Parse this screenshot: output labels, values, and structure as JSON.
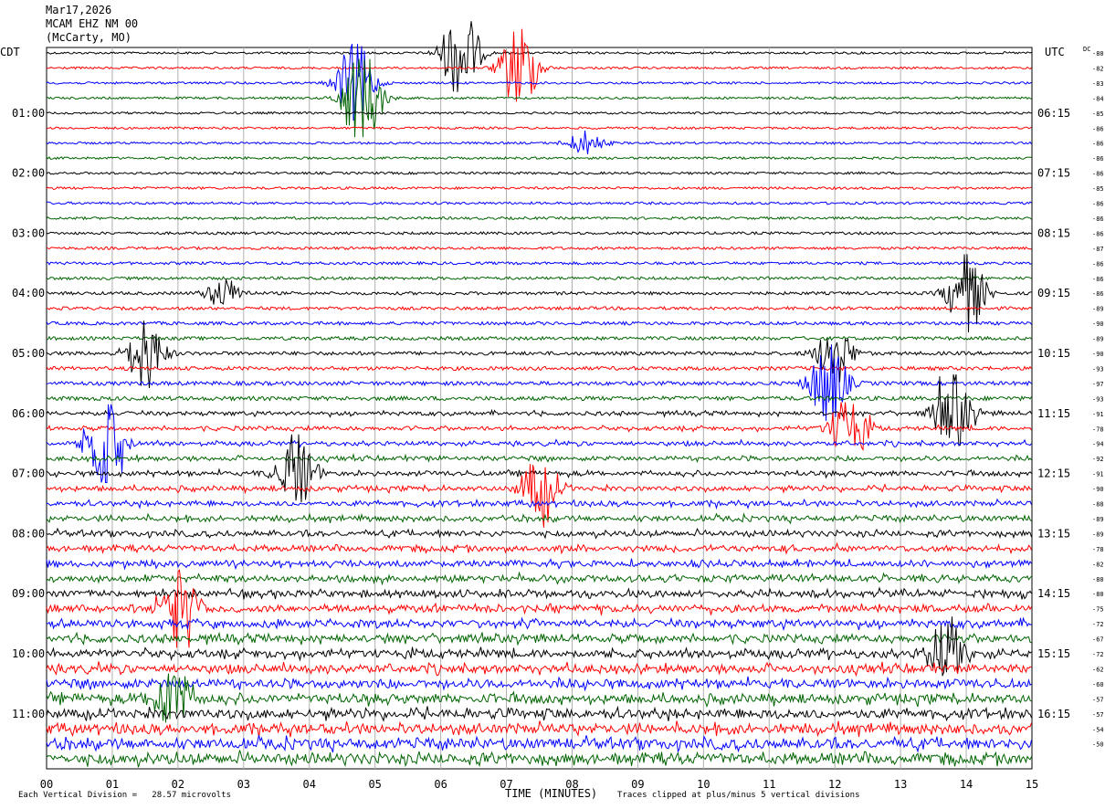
{
  "header": {
    "date": "Mar17,2026",
    "station": "MCAM EHZ NM 00",
    "location": "(McCarty, MO)"
  },
  "left_tz": "CDT",
  "right_tz": "UTC",
  "dc_label": "DC",
  "footer": {
    "scale_note": "Each Vertical Division =   28.57 microvolts",
    "clip_note": "Traces clipped at plus/minus 5 vertical divisions"
  },
  "chart_data": {
    "type": "line",
    "title": "",
    "xlabel": "TIME (MINUTES)",
    "xlim": [
      0,
      15
    ],
    "x_ticks": [
      "00",
      "01",
      "02",
      "03",
      "04",
      "05",
      "06",
      "07",
      "08",
      "09",
      "10",
      "11",
      "12",
      "13",
      "14",
      "15"
    ],
    "trace_colors": [
      "#000000",
      "#ff0000",
      "#0000ff",
      "#006400"
    ],
    "left_hour_labels": [
      "01:00",
      "02:00",
      "03:00",
      "04:00",
      "05:00",
      "06:00",
      "07:00",
      "08:00",
      "09:00",
      "10:00",
      "11:00"
    ],
    "right_hour_labels": [
      "06:15",
      "07:15",
      "08:15",
      "09:15",
      "10:15",
      "11:15",
      "12:15",
      "13:15",
      "14:15",
      "15:15",
      "16:15"
    ],
    "dc_offsets": [
      "-80",
      "-82",
      "-83",
      "-84",
      "-85",
      "-86",
      "-86",
      "-86",
      "-86",
      "-85",
      "-86",
      "-86",
      "-86",
      "-87",
      "-86",
      "-86",
      "-86",
      "-89",
      "-90",
      "-89",
      "-90",
      "-93",
      "-97",
      "-93",
      "-91",
      "-78",
      "-94",
      "-92",
      "-91",
      "-90",
      "-88",
      "-89",
      "-89",
      "-78",
      "-82",
      "-80",
      "-80",
      "-75",
      "-72",
      "-67",
      "-72",
      "-62",
      "-60",
      "-57",
      "-57",
      "-54",
      "-50"
    ],
    "num_traces": 48,
    "trace_minutes_per_line": 15,
    "events": [
      {
        "trace": 0,
        "minute": 6.3,
        "amp": 3.5
      },
      {
        "trace": 1,
        "minute": 7.2,
        "amp": 3.2
      },
      {
        "trace": 3,
        "minute": 4.8,
        "amp": 4.5
      },
      {
        "trace": 2,
        "minute": 4.7,
        "amp": 3.0
      },
      {
        "trace": 6,
        "minute": 8.2,
        "amp": 0.8
      },
      {
        "trace": 16,
        "minute": 14.0,
        "amp": 3.0
      },
      {
        "trace": 16,
        "minute": 2.7,
        "amp": 1.0
      },
      {
        "trace": 20,
        "minute": 1.5,
        "amp": 2.5
      },
      {
        "trace": 20,
        "minute": 12.0,
        "amp": 2.0
      },
      {
        "trace": 22,
        "minute": 11.9,
        "amp": 3.0
      },
      {
        "trace": 24,
        "minute": 13.8,
        "amp": 2.8
      },
      {
        "trace": 25,
        "minute": 12.2,
        "amp": 2.5
      },
      {
        "trace": 26,
        "minute": 0.9,
        "amp": 4.0
      },
      {
        "trace": 28,
        "minute": 3.8,
        "amp": 3.0
      },
      {
        "trace": 29,
        "minute": 7.5,
        "amp": 2.5
      },
      {
        "trace": 37,
        "minute": 2.0,
        "amp": 3.0
      },
      {
        "trace": 40,
        "minute": 13.7,
        "amp": 2.5
      },
      {
        "trace": 43,
        "minute": 1.9,
        "amp": 3.0
      }
    ]
  }
}
